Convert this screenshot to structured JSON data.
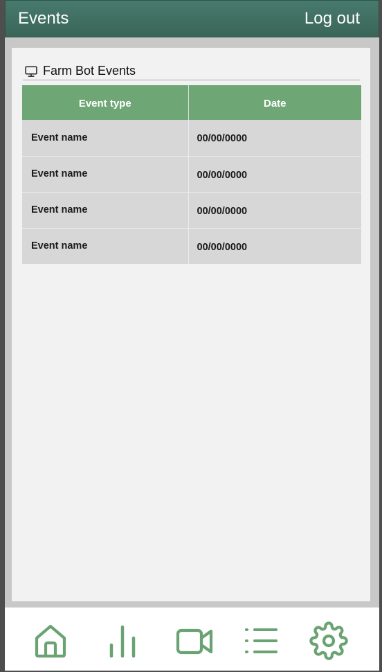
{
  "header": {
    "title": "Events",
    "logout_label": "Log out"
  },
  "panel": {
    "title": "Farm Bot Events",
    "icon": "monitor-icon"
  },
  "table": {
    "columns": [
      "Event type",
      "Date"
    ],
    "rows": [
      [
        "Event name",
        "00/00/0000"
      ],
      [
        "Event name",
        "00/00/0000"
      ],
      [
        "Event name",
        "00/00/0000"
      ],
      [
        "Event name",
        "00/00/0000"
      ]
    ]
  },
  "navbar": {
    "items": [
      "home-icon",
      "bar-chart-icon",
      "video-camera-icon",
      "list-icon",
      "gear-icon"
    ]
  },
  "colors": {
    "header_bg": "#3f6f62",
    "accent_green": "#6fa676",
    "icon_green": "#6aa373",
    "row_bg": "#d7d7d7",
    "panel_bg": "#f2f2f2"
  }
}
